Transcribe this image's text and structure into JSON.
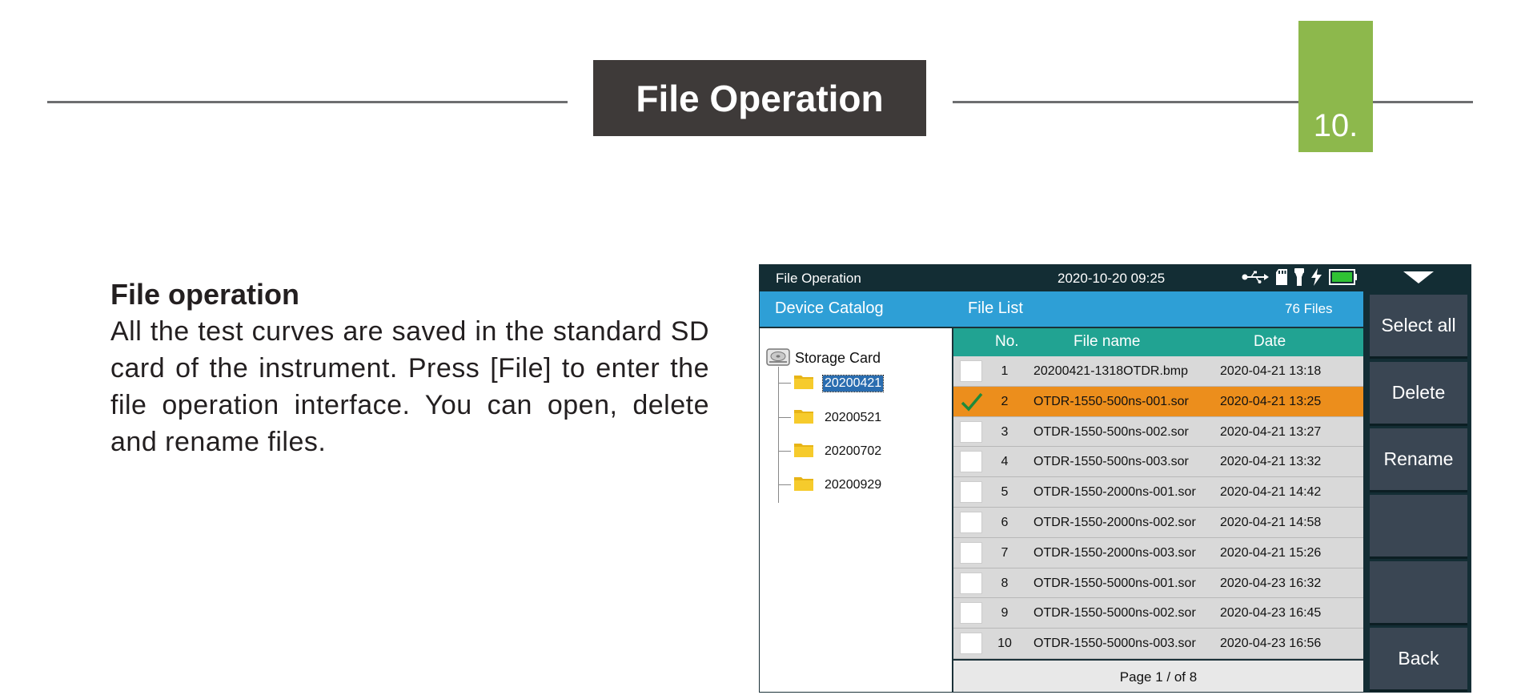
{
  "page": {
    "title": "File Operation",
    "chapter": "10.",
    "heading": "File operation",
    "body": "All the test curves are saved in the standard SD card of the instrument. Press [File] to enter the file operation interface. You can open, delete and rename files."
  },
  "screen": {
    "status": {
      "title": "File Operation",
      "datetime": "2020-10-20 09:25"
    },
    "catalog": {
      "header": "Device Catalog",
      "root": "Storage Card",
      "folders": [
        "20200421",
        "20200521",
        "20200702",
        "20200929"
      ],
      "selected_folder": "20200421"
    },
    "file_list": {
      "header": "File List",
      "count": "76 Files",
      "columns": {
        "no": "No.",
        "name": "File name",
        "date": "Date"
      },
      "rows": [
        {
          "no": "1",
          "name": "20200421-1318OTDR.bmp",
          "date": "2020-04-21 13:18",
          "checked": false
        },
        {
          "no": "2",
          "name": "OTDR-1550-500ns-001.sor",
          "date": "2020-04-21 13:25",
          "checked": true
        },
        {
          "no": "3",
          "name": "OTDR-1550-500ns-002.sor",
          "date": "2020-04-21 13:27",
          "checked": false
        },
        {
          "no": "4",
          "name": "OTDR-1550-500ns-003.sor",
          "date": "2020-04-21 13:32",
          "checked": false
        },
        {
          "no": "5",
          "name": "OTDR-1550-2000ns-001.sor",
          "date": "2020-04-21 14:42",
          "checked": false
        },
        {
          "no": "6",
          "name": "OTDR-1550-2000ns-002.sor",
          "date": "2020-04-21 14:58",
          "checked": false
        },
        {
          "no": "7",
          "name": "OTDR-1550-2000ns-003.sor",
          "date": "2020-04-21 15:26",
          "checked": false
        },
        {
          "no": "8",
          "name": "OTDR-1550-5000ns-001.sor",
          "date": "2020-04-23 16:32",
          "checked": false
        },
        {
          "no": "9",
          "name": "OTDR-1550-5000ns-002.sor",
          "date": "2020-04-23 16:45",
          "checked": false
        },
        {
          "no": "10",
          "name": "OTDR-1550-5000ns-003.sor",
          "date": "2020-04-23 16:56",
          "checked": false
        }
      ],
      "pager": "Page 1 / of 8"
    },
    "buttons": {
      "select_all": "Select all",
      "delete": "Delete",
      "rename": "Rename",
      "empty_1": "",
      "empty_2": "",
      "back": "Back"
    }
  },
  "colors": {
    "title_bg": "#3e3a39",
    "chapter_tab": "#8db84c",
    "header_blue": "#2e9fd6",
    "table_head_teal": "#21a392",
    "selected_row_orange": "#ec8e1c",
    "status_bar": "#132d34"
  },
  "icons": {
    "status": [
      "usb-icon",
      "sd-card-icon",
      "flashlight-icon",
      "charging-icon",
      "battery-icon"
    ],
    "tree": [
      "storage-card-icon",
      "folder-icon"
    ],
    "selection": "checkmark-icon"
  }
}
